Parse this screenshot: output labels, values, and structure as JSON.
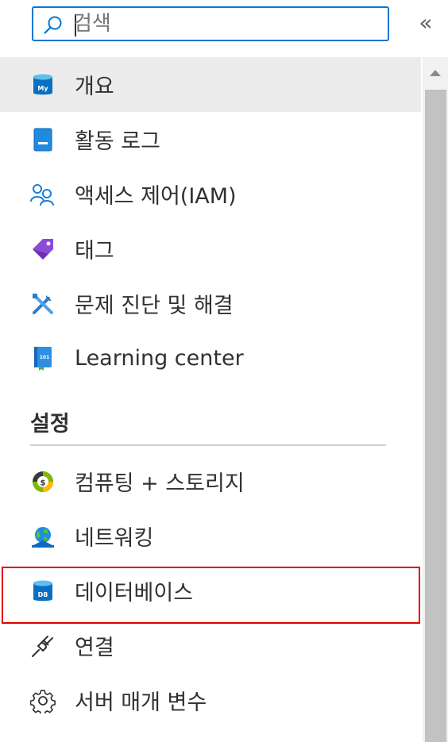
{
  "search": {
    "placeholder": "검색",
    "value": ""
  },
  "collapse_label": "«",
  "nav": {
    "items": [
      {
        "label": "개요",
        "icon": "mysql-db-icon",
        "selected": true
      },
      {
        "label": "활동 로그",
        "icon": "activity-log-icon"
      },
      {
        "label": "액세스 제어(IAM)",
        "icon": "users-icon"
      },
      {
        "label": "태그",
        "icon": "tag-icon"
      },
      {
        "label": "문제 진단 및 해결",
        "icon": "tools-icon"
      },
      {
        "label": "Learning center",
        "icon": "learning-book-icon"
      }
    ]
  },
  "settings": {
    "title": "설정",
    "items": [
      {
        "label": "컴퓨팅 + 스토리지",
        "icon": "compute-storage-icon"
      },
      {
        "label": "네트워킹",
        "icon": "networking-globe-icon"
      },
      {
        "label": "데이터베이스",
        "icon": "database-icon",
        "highlighted": true
      },
      {
        "label": "연결",
        "icon": "plug-icon"
      },
      {
        "label": "서버 매개 변수",
        "icon": "gear-icon"
      }
    ]
  },
  "colors": {
    "accent": "#0078d4",
    "highlight_border": "#e00000",
    "selected_bg": "#ececec"
  }
}
